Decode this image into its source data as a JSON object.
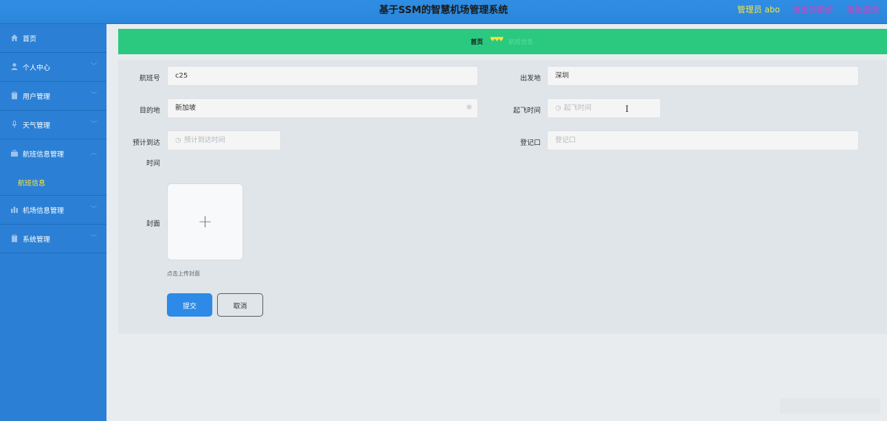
{
  "header": {
    "title": "基于SSM的智慧机场管理系统",
    "admin": "管理员 abo",
    "to_front": "退出到前台",
    "logout": "退出登录"
  },
  "sidebar": {
    "items": [
      {
        "label": "首页",
        "icon": "home-icon",
        "expandable": false
      },
      {
        "label": "个人中心",
        "icon": "user-icon",
        "expandable": true
      },
      {
        "label": "用户管理",
        "icon": "clipboard-icon",
        "expandable": true
      },
      {
        "label": "天气管理",
        "icon": "microphone-icon",
        "expandable": true
      },
      {
        "label": "航班信息管理",
        "icon": "briefcase-icon",
        "expandable": true,
        "expanded": true
      },
      {
        "label": "机场信息管理",
        "icon": "chart-icon",
        "expandable": true
      },
      {
        "label": "系统管理",
        "icon": "clipboard-icon",
        "expandable": true
      }
    ],
    "submenu": {
      "label": "航班信息"
    }
  },
  "breadcrumb": {
    "home": "首页",
    "separator": "♥♥♥",
    "current": "航班信息"
  },
  "form": {
    "flight_no": {
      "label": "航班号",
      "value": "c25"
    },
    "origin": {
      "label": "出发地",
      "value": "深圳"
    },
    "destination": {
      "label": "目的地",
      "value": "新加坡"
    },
    "departure_time": {
      "label": "起飞时间",
      "placeholder": "起飞时间"
    },
    "arrival_time": {
      "label_line1": "预计到达",
      "label_line2": "时间",
      "placeholder": "预计到达时间"
    },
    "gate": {
      "label": "登记口",
      "placeholder": "登记口"
    },
    "cover": {
      "label": "封面",
      "hint": "点击上传封面"
    },
    "submit_label": "提交",
    "cancel_label": "取消"
  },
  "colors": {
    "header_bg": "#2f8ee4",
    "sidebar_bg": "#2b80d5",
    "breadcrumb_bg": "#2ac97f",
    "accent_yellow": "#f4e442",
    "accent_magenta": "#d93ec3",
    "submit_bg": "#2d8ae6"
  }
}
